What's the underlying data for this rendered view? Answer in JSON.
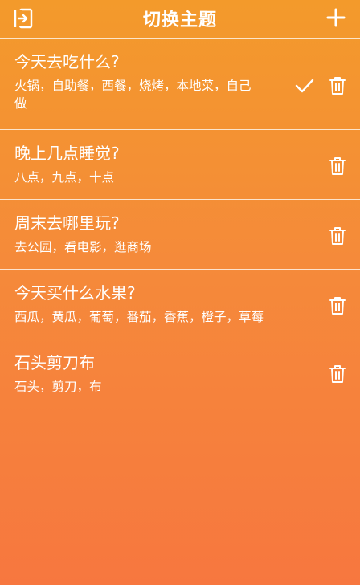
{
  "header": {
    "title": "切换主题",
    "exit_icon": "exit-icon",
    "add_icon": "plus-icon"
  },
  "topics": [
    {
      "title": "今天去吃什么?",
      "options": "火锅，自助餐，西餐，烧烤，本地菜，自己做",
      "selected": true
    },
    {
      "title": "晚上几点睡觉?",
      "options": "八点，九点，十点",
      "selected": false
    },
    {
      "title": "周末去哪里玩?",
      "options": "去公园，看电影，逛商场",
      "selected": false
    },
    {
      "title": "今天买什么水果?",
      "options": "西瓜，黄瓜，葡萄，番茄，香蕉，橙子，草莓",
      "selected": false
    },
    {
      "title": "石头剪刀布",
      "options": "石头，剪刀，布",
      "selected": false
    }
  ],
  "colors": {
    "gradient_top": "#f39a2b",
    "gradient_bottom": "#f7773f",
    "text": "#ffffff"
  }
}
